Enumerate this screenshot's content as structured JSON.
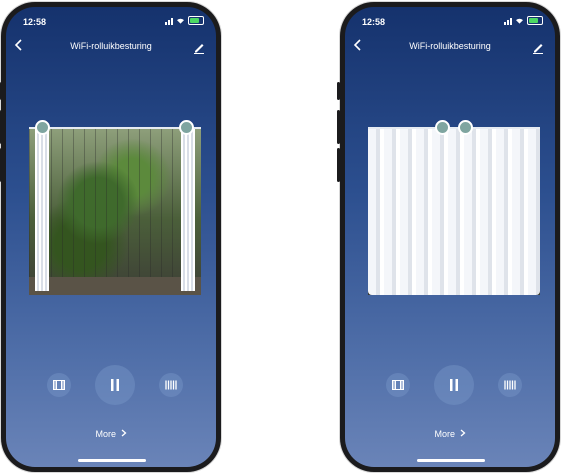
{
  "screens": [
    {
      "id": "open",
      "status": {
        "time": "12:58"
      },
      "nav": {
        "title": "WiFi-rolluikbesturing",
        "back_icon": "chevron-left-icon",
        "edit_icon": "pencil-icon"
      },
      "curtain_state": "open",
      "controls": {
        "open_icon": "curtain-open-icon",
        "pause_icon": "pause-icon",
        "close_icon": "curtain-close-icon"
      },
      "more_label": "More"
    },
    {
      "id": "closed",
      "status": {
        "time": "12:58"
      },
      "nav": {
        "title": "WiFi-rolluikbesturing",
        "back_icon": "chevron-left-icon",
        "edit_icon": "pencil-icon"
      },
      "curtain_state": "closed",
      "controls": {
        "open_icon": "curtain-open-icon",
        "pause_icon": "pause-icon",
        "close_icon": "curtain-close-icon"
      },
      "more_label": "More"
    }
  ]
}
